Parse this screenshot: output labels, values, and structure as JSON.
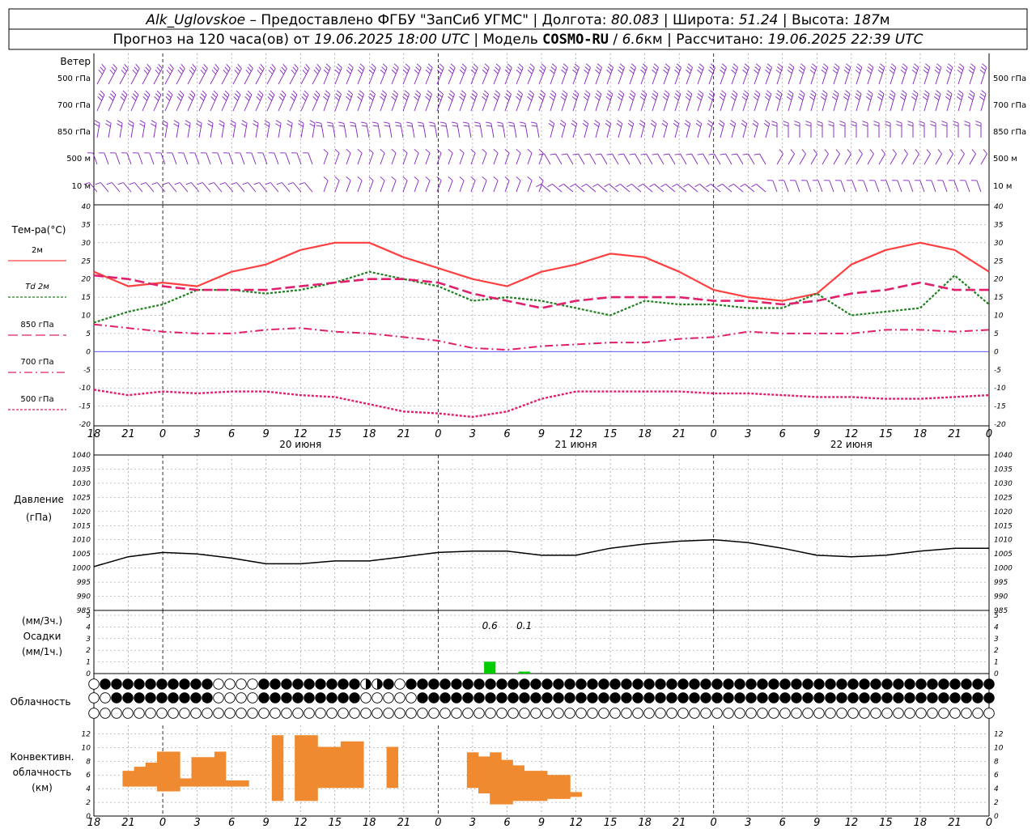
{
  "header": {
    "station": "Alk_Uglovskoe",
    "sep1": " – Предоставлено ФГБУ \"ЗапСиб УГМС\" | Долгота: ",
    "lon": "80.083",
    "sep2": " | Широта: ",
    "lat": "51.24",
    "sep3": " | Высота: ",
    "alt": "187",
    "alt_unit": "м",
    "line2_a": "Прогноз на 120 часа(ов) от ",
    "run_time": "19.06.2025 18:00 UTC",
    "line2_b": "  | Модель ",
    "model": "COSMO-RU",
    "model_sep": " / ",
    "res": "6.6",
    "res_unit": "км",
    "line2_c": " | Рассчитано: ",
    "calc_time": "19.06.2025 22:39 UTC"
  },
  "labels": {
    "wind_title": "Ветер",
    "temp_title": "Тем-ра(°С)",
    "pressure_title": "Давление",
    "pressure_unit": "(гПа)",
    "precip_unit_3h": "(мм/3ч.)",
    "precip_title": "Осадки",
    "precip_unit_1h": "(мм/1ч.)",
    "cloud_title": "Облачность",
    "conv_title_1": "Конвективн.",
    "conv_title_2": "облачность",
    "conv_unit": "(км)"
  },
  "wind_levels": [
    "500 гПа",
    "700 гПа",
    "850 гПа",
    "500  м",
    "10  м"
  ],
  "temp_legend": [
    {
      "label": "2м",
      "color": "#ff4040",
      "dash": ""
    },
    {
      "label": "Td  2м",
      "color": "#208020",
      "dash": "3,2"
    },
    {
      "label": "850 гПа",
      "color": "#e0206c",
      "dash": "10,4"
    },
    {
      "label": "700 гПа",
      "color": "#e0206c",
      "dash": "8,3,2,3"
    },
    {
      "label": "500 гПа",
      "color": "#e0206c",
      "dash": "3,2"
    }
  ],
  "time_axis": {
    "hour_labels": [
      "18",
      "21",
      "0",
      "3",
      "6",
      "9",
      "12",
      "15",
      "18",
      "21",
      "0",
      "3",
      "6",
      "9",
      "12",
      "15",
      "18",
      "21",
      "0",
      "3",
      "6",
      "9",
      "12",
      "15",
      "18",
      "21",
      "0"
    ],
    "days": [
      "20 июня",
      "21 июня",
      "22 июня"
    ]
  },
  "colors": {
    "t2m": "#ff4040",
    "td": "#208020",
    "upper": "#e0206c",
    "wind": "#8020c0",
    "pressure": "#000000",
    "precip": "#00cc00",
    "conv": "#f08a30",
    "zero_line": "#4040ff",
    "grid": "#888888"
  },
  "chart_data": [
    {
      "type": "line",
      "title": "Тем-ра(°С)",
      "x_unit": "hours from 19.06.2025 18:00 UTC",
      "xlim": [
        0,
        78
      ],
      "ylim": [
        -20,
        40
      ],
      "y_ticks": [
        -20,
        -15,
        -10,
        -5,
        0,
        5,
        10,
        15,
        20,
        25,
        30,
        35,
        40
      ],
      "series": [
        {
          "name": "2м",
          "x": [
            0,
            3,
            6,
            9,
            12,
            15,
            18,
            21,
            24,
            27,
            30,
            33,
            36,
            39,
            42,
            45,
            48,
            51,
            54,
            57,
            60,
            63,
            66,
            69,
            72,
            75,
            78
          ],
          "values": [
            22,
            18,
            19,
            18,
            22,
            24,
            28,
            30,
            30,
            26,
            23,
            20,
            18,
            22,
            24,
            27,
            26,
            22,
            17,
            15,
            14,
            16,
            24,
            28,
            30,
            28,
            22
          ]
        },
        {
          "name": "Td  2м",
          "x": [
            0,
            3,
            6,
            9,
            12,
            15,
            18,
            21,
            24,
            27,
            30,
            33,
            36,
            39,
            42,
            45,
            48,
            51,
            54,
            57,
            60,
            63,
            66,
            69,
            72,
            75,
            78
          ],
          "values": [
            8,
            11,
            13,
            17,
            17,
            16,
            17,
            19,
            22,
            20,
            18,
            14,
            15,
            14,
            12,
            10,
            14,
            13,
            13,
            12,
            12,
            16,
            10,
            11,
            12,
            21,
            13
          ]
        },
        {
          "name": "850 гПа",
          "x": [
            0,
            3,
            6,
            9,
            12,
            15,
            18,
            21,
            24,
            27,
            30,
            33,
            36,
            39,
            42,
            45,
            48,
            51,
            54,
            57,
            60,
            63,
            66,
            69,
            72,
            75,
            78
          ],
          "values": [
            21,
            20,
            18,
            17,
            17,
            17,
            18,
            19,
            20,
            20,
            19,
            16,
            14,
            12,
            14,
            15,
            15,
            15,
            14,
            14,
            13,
            14,
            16,
            17,
            19,
            17,
            17
          ]
        },
        {
          "name": "700 гПа",
          "x": [
            0,
            3,
            6,
            9,
            12,
            15,
            18,
            21,
            24,
            27,
            30,
            33,
            36,
            39,
            42,
            45,
            48,
            51,
            54,
            57,
            60,
            63,
            66,
            69,
            72,
            75,
            78
          ],
          "values": [
            7.5,
            6.5,
            5.5,
            5,
            5,
            6,
            6.5,
            5.5,
            5,
            4,
            3,
            1,
            0.5,
            1.5,
            2,
            2.5,
            2.5,
            3.5,
            4,
            5.5,
            5,
            5,
            5,
            6,
            6,
            5.5,
            6
          ]
        },
        {
          "name": "500 гПа",
          "x": [
            0,
            3,
            6,
            9,
            12,
            15,
            18,
            21,
            24,
            27,
            30,
            33,
            36,
            39,
            42,
            45,
            48,
            51,
            54,
            57,
            60,
            63,
            66,
            69,
            72,
            75,
            78
          ],
          "values": [
            -10.5,
            -12,
            -11,
            -11.5,
            -11,
            -11,
            -12,
            -12.5,
            -14.5,
            -16.5,
            -17,
            -18,
            -16.5,
            -13,
            -11,
            -11,
            -11,
            -11,
            -11.5,
            -11.5,
            -12,
            -12.5,
            -12.5,
            -13,
            -13,
            -12.5,
            -12
          ]
        }
      ]
    },
    {
      "type": "line",
      "title": "Давление",
      "ylabel": "(гПа)",
      "x_unit": "hours from 19.06.2025 18:00 UTC",
      "xlim": [
        0,
        78
      ],
      "ylim": [
        985,
        1040
      ],
      "y_ticks": [
        985,
        990,
        995,
        1000,
        1005,
        1010,
        1015,
        1020,
        1025,
        1030,
        1035,
        1040
      ],
      "series": [
        {
          "name": "",
          "x": [
            0,
            3,
            6,
            9,
            12,
            15,
            18,
            21,
            24,
            27,
            30,
            33,
            36,
            39,
            42,
            45,
            48,
            51,
            54,
            57,
            60,
            63,
            66,
            69,
            72,
            75,
            78
          ],
          "values": [
            1000.5,
            1004,
            1005.5,
            1005,
            1003.5,
            1001.5,
            1001.5,
            1002.5,
            1002.5,
            1004,
            1005.5,
            1006,
            1006,
            1004.5,
            1004.5,
            1007,
            1008.5,
            1009.5,
            1010,
            1009,
            1007,
            1004.5,
            1004,
            1004.5,
            1006,
            1007,
            1007
          ]
        }
      ]
    },
    {
      "type": "bar",
      "title": "Осадки",
      "ylabel": "(мм/3ч.) (мм/1ч.)",
      "x_unit": "hours from 19.06.2025 18:00 UTC",
      "ylim": [
        0,
        5
      ],
      "y_ticks": [
        0,
        1,
        2,
        3,
        4,
        5
      ],
      "bars": [
        {
          "x": 34.5,
          "value": 0.6
        },
        {
          "x": 37.5,
          "value": 0.1
        }
      ],
      "annotations": [
        {
          "x": 34.5,
          "text": "0.6"
        },
        {
          "x": 37.5,
          "text": "0.1"
        }
      ]
    },
    {
      "type": "bar",
      "title": "Конвективн. облачность",
      "ylabel": "(км)",
      "x_unit": "hours from 19.06.2025 18:00 UTC",
      "ylim": [
        0,
        13
      ],
      "y_ticks": [
        0,
        2,
        4,
        6,
        8,
        10,
        12
      ],
      "columns": [
        {
          "x": 3,
          "base": 4.3,
          "top": 6.6
        },
        {
          "x": 4,
          "base": 4.3,
          "top": 7.2
        },
        {
          "x": 5,
          "base": 4.3,
          "top": 7.8
        },
        {
          "x": 6,
          "base": 3.6,
          "top": 9.4
        },
        {
          "x": 7,
          "base": 3.6,
          "top": 9.4
        },
        {
          "x": 8,
          "base": 4.3,
          "top": 5.5
        },
        {
          "x": 9,
          "base": 4.3,
          "top": 8.6
        },
        {
          "x": 10,
          "base": 4.3,
          "top": 8.6
        },
        {
          "x": 11,
          "base": 4.3,
          "top": 9.4
        },
        {
          "x": 12,
          "base": 4.3,
          "top": 5.2
        },
        {
          "x": 13,
          "base": 4.3,
          "top": 5.2
        },
        {
          "x": 16,
          "base": 2.2,
          "top": 11.8
        },
        {
          "x": 18,
          "base": 2.2,
          "top": 11.8
        },
        {
          "x": 19,
          "base": 2.2,
          "top": 11.8
        },
        {
          "x": 20,
          "base": 4.1,
          "top": 10.1
        },
        {
          "x": 21,
          "base": 4.1,
          "top": 10.1
        },
        {
          "x": 22,
          "base": 4.1,
          "top": 10.9
        },
        {
          "x": 23,
          "base": 4.1,
          "top": 10.9
        },
        {
          "x": 26,
          "base": 4.1,
          "top": 10.1
        },
        {
          "x": 33,
          "base": 4.1,
          "top": 9.3
        },
        {
          "x": 34,
          "base": 3.3,
          "top": 8.7
        },
        {
          "x": 35,
          "base": 1.7,
          "top": 9.3
        },
        {
          "x": 36,
          "base": 1.7,
          "top": 8.2
        },
        {
          "x": 37,
          "base": 2.2,
          "top": 7.4
        },
        {
          "x": 38,
          "base": 2.2,
          "top": 6.6
        },
        {
          "x": 39,
          "base": 2.2,
          "top": 6.6
        },
        {
          "x": 40,
          "base": 2.5,
          "top": 6.0
        },
        {
          "x": 41,
          "base": 2.5,
          "top": 6.0
        },
        {
          "x": 42,
          "base": 2.8,
          "top": 3.5
        }
      ]
    }
  ],
  "cloud_cover": {
    "levels": [
      "upper",
      "middle",
      "lower"
    ],
    "codes": [
      "04444444444000044444444422404444444444444444444444444444444444444444444444444444",
      "00444444444000044444444400000444444444444444444444444444444444444444444444444444",
      "00000000000000000000000000000000000000000000000000000000000000000000000000000000"
    ]
  }
}
